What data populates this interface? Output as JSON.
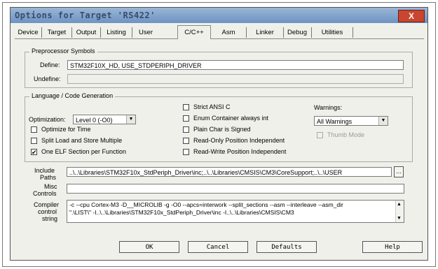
{
  "window": {
    "title": "Options for Target 'RS422'",
    "close_glyph": "X"
  },
  "tabs": [
    "Device",
    "Target",
    "Output",
    "Listing",
    "User",
    "C/C++",
    "Asm",
    "Linker",
    "Debug",
    "Utilities"
  ],
  "active_tab": "C/C++",
  "preprocessor": {
    "group_label": "Preprocessor Symbols",
    "define_label": "Define:",
    "define_value": "STM32F10X_HD, USE_STDPERIPH_DRIVER",
    "undefine_label": "Undefine:",
    "undefine_value": ""
  },
  "language": {
    "group_label": "Language / Code Generation",
    "optimization_label": "Optimization:",
    "optimization_value": "Level 0 (-O0)",
    "optimize_time": {
      "label": "Optimize for Time",
      "checked": false
    },
    "split_load": {
      "label": "Split Load and Store Multiple",
      "checked": false
    },
    "one_elf": {
      "label": "One ELF Section per Function",
      "checked": true
    },
    "strict_ansi": {
      "label": "Strict ANSI C",
      "checked": false
    },
    "enum_container": {
      "label": "Enum Container always int",
      "checked": false
    },
    "plain_char": {
      "label": "Plain Char is Signed",
      "checked": false
    },
    "ro_pos": {
      "label": "Read-Only Position Independent",
      "checked": false
    },
    "rw_pos": {
      "label": "Read-Write Position Independent",
      "checked": false
    },
    "warnings_label": "Warnings:",
    "warnings_value": "All Warnings",
    "thumb_mode": {
      "label": "Thumb Mode",
      "checked": false
    }
  },
  "include": {
    "label_line1": "Include",
    "label_line2": "Paths",
    "value": "..\\..\\Libraries\\STM32F10x_StdPeriph_Driver\\inc;..\\..\\Libraries\\CMSIS\\CM3\\CoreSupport;..\\..\\USER",
    "browse_label": "..."
  },
  "misc": {
    "label_line1": "Misc",
    "label_line2": "Controls",
    "value": ""
  },
  "compiler": {
    "label_line1": "Compiler",
    "label_line2": "control",
    "label_line3": "string",
    "line1": "-c --cpu Cortex-M3 -D__MICROLIB -g -O0 --apcs=interwork --split_sections --asm --interleave --asm_dir",
    "line2": "\".\\LIST\\\" -I..\\..\\Libraries\\STM32F10x_StdPeriph_Driver\\inc -I..\\..\\Libraries\\CMSIS\\CM3"
  },
  "buttons": {
    "ok": "OK",
    "cancel": "Cancel",
    "defaults": "Defaults",
    "help": "Help"
  }
}
